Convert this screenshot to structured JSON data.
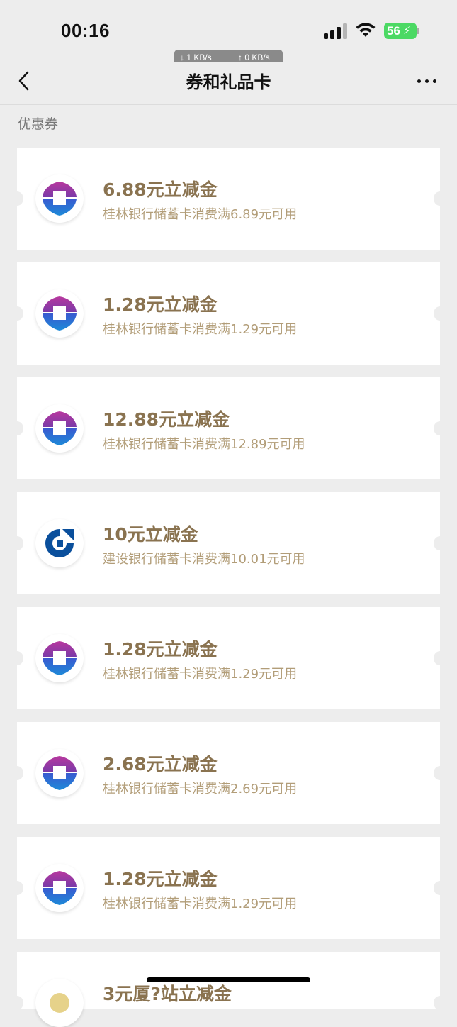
{
  "status_bar": {
    "time": "00:16",
    "battery": "56",
    "net_down": "↓ 1 KB/s",
    "net_up": "↑ 0 KB/s"
  },
  "nav": {
    "title": "券和礼品卡"
  },
  "section_label": "优惠券",
  "colors": {
    "accent_title": "#8a7350",
    "accent_desc": "#b29d78",
    "background": "#ededed",
    "battery": "#4cd964"
  },
  "coupons": [
    {
      "title": "6.88元立减金",
      "desc": "桂林银行储蓄卡消费满6.89元可用",
      "logo": "guilin-bank-logo-icon"
    },
    {
      "title": "1.28元立减金",
      "desc": "桂林银行储蓄卡消费满1.29元可用",
      "logo": "guilin-bank-logo-icon"
    },
    {
      "title": "12.88元立减金",
      "desc": "桂林银行储蓄卡消费满12.89元可用",
      "logo": "guilin-bank-logo-icon"
    },
    {
      "title": "10元立减金",
      "desc": "建设银行储蓄卡消费满10.01元可用",
      "logo": "ccb-logo-icon"
    },
    {
      "title": "1.28元立减金",
      "desc": "桂林银行储蓄卡消费满1.29元可用",
      "logo": "guilin-bank-logo-icon"
    },
    {
      "title": "2.68元立减金",
      "desc": "桂林银行储蓄卡消费满2.69元可用",
      "logo": "guilin-bank-logo-icon"
    },
    {
      "title": "1.28元立减金",
      "desc": "桂林银行储蓄卡消费满1.29元可用",
      "logo": "guilin-bank-logo-icon"
    },
    {
      "title": "3元厦?站立减金",
      "desc": "",
      "logo": "generic-logo-icon"
    }
  ]
}
